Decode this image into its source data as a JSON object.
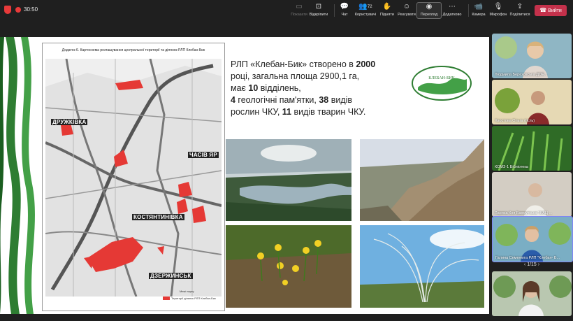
{
  "meeting": {
    "timer": "30:50",
    "toolbar": [
      {
        "icon": "share-screen-icon",
        "label": "Показати",
        "dim": true
      },
      {
        "icon": "unpin-icon",
        "label": "Відкріпити",
        "dim": false
      },
      {
        "icon": "chat-icon",
        "label": "Чат",
        "dim": false
      },
      {
        "icon": "people-icon",
        "label": "Користувачі",
        "dim": false,
        "badge": "72"
      },
      {
        "icon": "raise-hand-icon",
        "label": "Підняти",
        "dim": false
      },
      {
        "icon": "react-icon",
        "label": "Реагувати",
        "dim": false
      },
      {
        "icon": "view-icon",
        "label": "Перегляд",
        "dim": false,
        "active": true
      },
      {
        "icon": "more-icon",
        "label": "Додатково",
        "dim": false
      }
    ],
    "media": [
      {
        "icon": "camera-icon",
        "label": "Камера"
      },
      {
        "icon": "mic-off-icon",
        "label": "Мікрофон"
      },
      {
        "icon": "share-icon",
        "label": "Поділитися"
      }
    ],
    "leave_label": "Вийти"
  },
  "slide": {
    "map_title": "Додаток 6. Картосхема розташування центральної території та ділянок РЛП Клебан-Бик",
    "map_labels": [
      "ДРУЖКІВКА",
      "ЧАСІВ ЯР",
      "КОСТЯНТИНІВКА",
      "ДЗЕРЖИНСЬК"
    ],
    "legend": [
      "Межі парку",
      "Території ділянок РЛП Клебан-Бик"
    ],
    "text_html_parts": {
      "line1_a": "РЛП «Клебан-Бик» створено в ",
      "year": "2000",
      "line2": "році, загальна площа 2900,1 га,",
      "line3_a": "має ",
      "units": "10",
      "line3_b": " відділень,",
      "line4_a": "4",
      "line4_b": " геологічні пам'ятки, ",
      "line4_c": "38",
      "line4_d": " видів",
      "line5": "рослин ЧКУ, ",
      "line5_b": "11",
      "line5_c": " видів тварин ЧКУ."
    },
    "logo_text": "КЛЕБАН-БИК"
  },
  "participants": [
    {
      "name": "Людмила Березовська ДОЕ...",
      "bg": "#7aa6b8"
    },
    {
      "name": "Хвостова Ольга (гість)",
      "bg": "#c8b46a"
    },
    {
      "name": "КОМЗ-1 Бібліотека",
      "bg": "#3f8a2e"
    },
    {
      "name": "Лариса Кня Бахмутська 'ЖАЦ ...",
      "bg": "#cfc9c0"
    },
    {
      "name": "Галина Семенюта РЛП \"Клебан- Б...",
      "bg": "#7aa6b8"
    },
    {
      "name": "",
      "bg": "#b9c7b0"
    }
  ],
  "pager": "1/15"
}
